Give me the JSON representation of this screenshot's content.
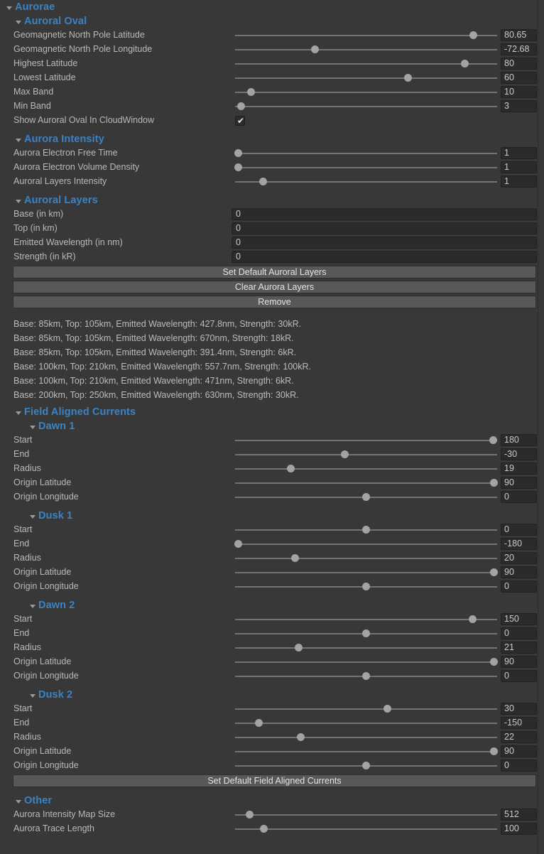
{
  "window": {
    "background_color": "#383838",
    "header_color": "#3b83c4",
    "label_color": "#b9b9b9",
    "button_color": "#585858",
    "field_color": "#2b2b2b"
  },
  "sections": {
    "aurorae": "Aurorae",
    "auroral_oval": "Auroral Oval",
    "aurora_intensity": "Aurora Intensity",
    "auroral_layers": "Auroral Layers",
    "field_aligned_currents": "Field Aligned Currents",
    "dawn1": "Dawn 1",
    "dusk1": "Dusk 1",
    "dawn2": "Dawn 2",
    "dusk2": "Dusk 2",
    "other": "Other"
  },
  "auroral_oval": {
    "rows": [
      {
        "label": "Geomagnetic North Pole Latitude",
        "value": "80.65",
        "knob_pct": 91.0
      },
      {
        "label": "Geomagnetic North Pole Longitude",
        "value": "-72.68",
        "knob_pct": 30.5
      },
      {
        "label": "Highest Latitude",
        "value": "80",
        "knob_pct": 87.8
      },
      {
        "label": "Lowest Latitude",
        "value": "60",
        "knob_pct": 66.1
      },
      {
        "label": "Max Band",
        "value": "10",
        "knob_pct": 6.2
      },
      {
        "label": "Min Band",
        "value": "3",
        "knob_pct": 2.4
      }
    ],
    "checkbox_row": {
      "label": "Show Auroral Oval In CloudWindow",
      "checked": true,
      "tick": "✔"
    }
  },
  "aurora_intensity": {
    "rows": [
      {
        "label": "Aurora Electron Free Time",
        "value": "1",
        "knob_pct": 1.3
      },
      {
        "label": "Aurora Electron Volume Density",
        "value": "1",
        "knob_pct": 1.3
      },
      {
        "label": "Auroral Layers Intensity",
        "value": "1",
        "knob_pct": 10.8
      }
    ]
  },
  "auroral_layers": {
    "rows": [
      {
        "label": "Base (in km)",
        "value": "0"
      },
      {
        "label": "Top (in km)",
        "value": "0"
      },
      {
        "label": "Emitted Wavelength (in nm)",
        "value": "0"
      },
      {
        "label": "Strength (in kR)",
        "value": "0"
      }
    ],
    "buttons": [
      "Set Default Auroral Layers",
      "Clear Aurora Layers",
      "Remove"
    ],
    "info_lines": [
      "Base: 85km, Top: 105km, Emitted Wavelength: 427.8nm, Strength: 30kR.",
      "Base: 85km, Top: 105km, Emitted Wavelength: 670nm, Strength: 18kR.",
      "Base: 85km, Top: 105km, Emitted Wavelength: 391.4nm, Strength: 6kR.",
      "Base: 100km, Top: 210km, Emitted Wavelength: 557.7nm, Strength: 100kR.",
      "Base: 100km, Top: 210km, Emitted Wavelength: 471nm, Strength: 6kR.",
      "Base: 200km, Top: 250km, Emitted Wavelength: 630nm, Strength: 30kR."
    ]
  },
  "field_aligned_currents": {
    "dawn1": [
      {
        "label": "Start",
        "value": "180",
        "knob_pct": 98.6
      },
      {
        "label": "End",
        "value": "-30",
        "knob_pct": 41.8
      },
      {
        "label": "Radius",
        "value": "19",
        "knob_pct": 21.4
      },
      {
        "label": "Origin Latitude",
        "value": "90",
        "knob_pct": 98.9
      },
      {
        "label": "Origin Longitude",
        "value": "0",
        "knob_pct": 49.9
      }
    ],
    "dusk1": [
      {
        "label": "Start",
        "value": "0",
        "knob_pct": 49.9
      },
      {
        "label": "End",
        "value": "-180",
        "knob_pct": 1.3
      },
      {
        "label": "Radius",
        "value": "20",
        "knob_pct": 22.8
      },
      {
        "label": "Origin Latitude",
        "value": "90",
        "knob_pct": 98.9
      },
      {
        "label": "Origin Longitude",
        "value": "0",
        "knob_pct": 49.9
      }
    ],
    "dawn2": [
      {
        "label": "Start",
        "value": "150",
        "knob_pct": 90.6
      },
      {
        "label": "End",
        "value": "0",
        "knob_pct": 49.9
      },
      {
        "label": "Radius",
        "value": "21",
        "knob_pct": 24.2
      },
      {
        "label": "Origin Latitude",
        "value": "90",
        "knob_pct": 98.9
      },
      {
        "label": "Origin Longitude",
        "value": "0",
        "knob_pct": 49.9
      }
    ],
    "dusk2": [
      {
        "label": "Start",
        "value": "30",
        "knob_pct": 58.1
      },
      {
        "label": "End",
        "value": "-150",
        "knob_pct": 9.2
      },
      {
        "label": "Radius",
        "value": "22",
        "knob_pct": 25.2
      },
      {
        "label": "Origin Latitude",
        "value": "90",
        "knob_pct": 98.9
      },
      {
        "label": "Origin Longitude",
        "value": "0",
        "knob_pct": 49.9
      }
    ],
    "button": "Set Default Field Aligned Currents"
  },
  "other": {
    "rows": [
      {
        "label": "Aurora Intensity Map Size",
        "value": "512",
        "knob_pct": 5.6
      },
      {
        "label": "Aurora Trace Length",
        "value": "100",
        "knob_pct": 11.1
      }
    ]
  }
}
